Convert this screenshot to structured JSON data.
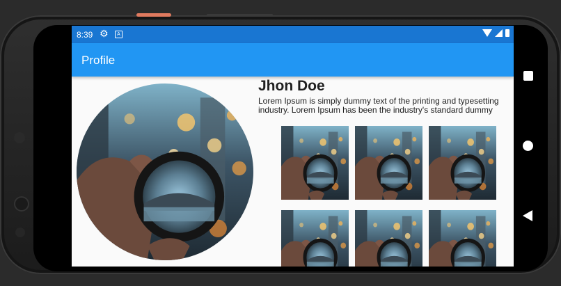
{
  "status_bar": {
    "time": "8:39"
  },
  "app_bar": {
    "title": "Profile"
  },
  "profile": {
    "name": "Jhon Doe",
    "description": "Lorem Ipsum is simply dummy text of the printing and typesetting industry. Lorem Ipsum has been the industry's standard dummy"
  },
  "gallery": {
    "count": 6
  },
  "colors": {
    "status_bar": "#1976d2",
    "app_bar": "#2196f3",
    "background": "#fafafa"
  },
  "icons": [
    "settings-icon",
    "a-notification-icon",
    "wifi-icon",
    "signal-icon",
    "battery-icon",
    "overview-icon",
    "home-icon",
    "back-icon"
  ]
}
